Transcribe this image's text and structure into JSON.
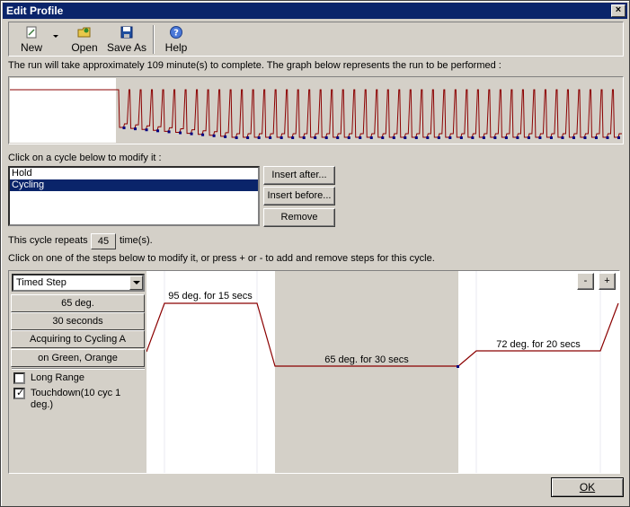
{
  "window": {
    "title": "Edit Profile",
    "close_glyph": "×"
  },
  "toolbar": {
    "new_label": "New",
    "open_label": "Open",
    "save_as_label": "Save As",
    "help_label": "Help"
  },
  "run_info": "The run will take approximately 109 minute(s) to complete. The graph below represents the run to be performed :",
  "cycle_prompt": "Click on a cycle below to modify it :",
  "cycles": [
    {
      "label": "Hold",
      "selected": false
    },
    {
      "label": "Cycling",
      "selected": true
    }
  ],
  "cycle_buttons": {
    "insert_after": "Insert after...",
    "insert_before": "Insert before...",
    "remove": "Remove"
  },
  "repeat": {
    "prefix": "This cycle repeats",
    "count": "45",
    "suffix": "time(s)."
  },
  "steps_prompt": "Click on one of the steps below to modify it, or press + or - to add and remove steps for this cycle.",
  "step_editor": {
    "step_type": "Timed Step",
    "temperature": "65 deg.",
    "duration": "30 seconds",
    "acquiring": "Acquiring to Cycling A",
    "channels": "on Green, Orange",
    "long_range_label": "Long Range",
    "long_range_checked": false,
    "touchdown_label": "Touchdown(10 cyc 1 deg.)",
    "touchdown_checked": true
  },
  "step_graph": {
    "minus_label": "-",
    "plus_label": "+",
    "steps": [
      {
        "label": "95 deg. for 15 secs"
      },
      {
        "label": "65 deg. for 30 secs"
      },
      {
        "label": "72 deg. for 20 secs"
      }
    ]
  },
  "ok_label": "OK",
  "colors": {
    "profile_line": "#8b0000",
    "acquire_marker": "#000080",
    "selected_bg": "#0a246a"
  }
}
